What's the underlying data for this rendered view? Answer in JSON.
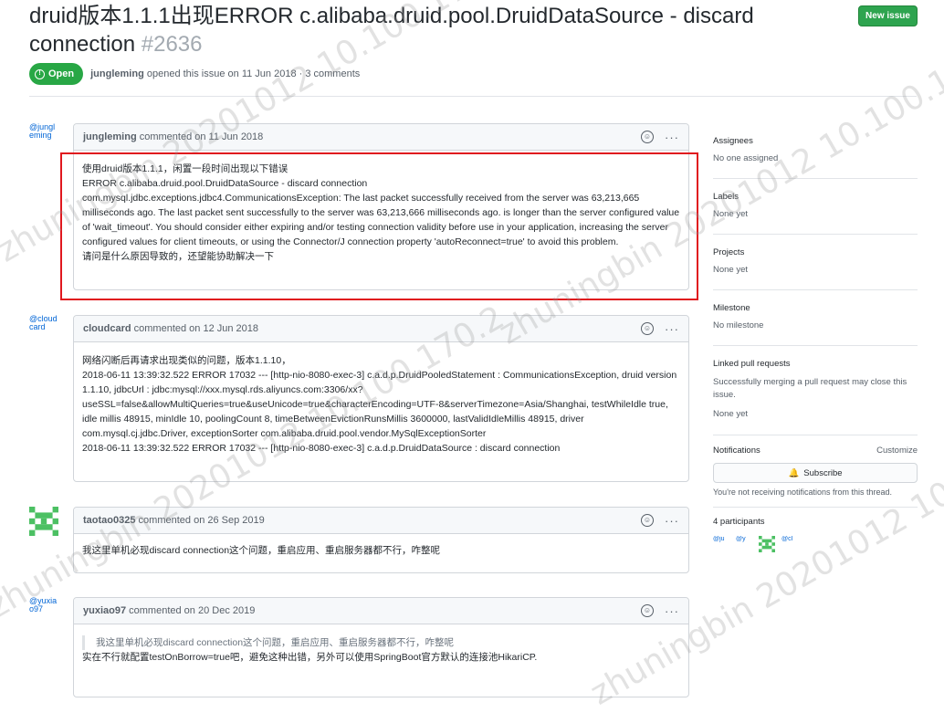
{
  "issue": {
    "title": "druid版本1.1.1出现ERROR c.alibaba.druid.pool.DruidDataSource - discard connection",
    "number": "#2636",
    "state": "Open",
    "author": "jungleming",
    "opened_text": "opened this issue on 11 Jun 2018 · 3 comments"
  },
  "header": {
    "new_issue_label": "New issue"
  },
  "comments": [
    {
      "avatar_alt": "@jungleming",
      "author": "jungleming",
      "date": "commented on 11 Jun 2018",
      "lines": [
        "使用druid版本1.1.1，闲置一段时间出现以下错误",
        "ERROR c.alibaba.druid.pool.DruidDataSource - discard connection",
        "com.mysql.jdbc.exceptions.jdbc4.CommunicationsException: The last packet successfully received from the server was 63,213,665 milliseconds ago. The last packet sent successfully to the server was 63,213,666 milliseconds ago. is longer than the server configured value of 'wait_timeout'. You should consider either expiring and/or testing connection validity before use in your application, increasing the server configured values for client timeouts, or using the Connector/J connection property 'autoReconnect=true' to avoid this problem.",
        "请问是什么原因导致的，还望能协助解决一下"
      ]
    },
    {
      "avatar_alt": "@cloudcard",
      "author": "cloudcard",
      "date": "commented on 12 Jun 2018",
      "lines": [
        "网络闪断后再请求出现类似的问题，版本1.1.10，",
        "2018-06-11 13:39:32.522 ERROR 17032 --- [http-nio-8080-exec-3] c.a.d.p.DruidPooledStatement : CommunicationsException, druid version 1.1.10, jdbcUrl : jdbc:mysql://xxx.mysql.rds.aliyuncs.com:3306/xx?useSSL=false&allowMultiQueries=true&useUnicode=true&characterEncoding=UTF-8&serverTimezone=Asia/Shanghai, testWhileIdle true, idle millis 48915, minIdle 10, poolingCount 8, timeBetweenEvictionRunsMillis 3600000, lastValidIdleMillis 48915, driver com.mysql.cj.jdbc.Driver, exceptionSorter com.alibaba.druid.pool.vendor.MySqlExceptionSorter",
        "2018-06-11 13:39:32.522 ERROR 17032 --- [http-nio-8080-exec-3] c.a.d.p.DruidDataSource : discard connection"
      ]
    },
    {
      "avatar_alt": "",
      "author": "taotao0325",
      "date": "commented on 26 Sep 2019",
      "lines": [
        "我这里单机必现discard connection这个问题，重启应用、重启服务器都不行，咋整呢"
      ]
    },
    {
      "avatar_alt": "@yuxiao97",
      "author": "yuxiao97",
      "date": "commented on 20 Dec 2019",
      "quote": "我这里单机必现discard connection这个问题，重启应用、重启服务器都不行，咋整呢",
      "lines": [
        "实在不行就配置testOnBorrow=true吧，避免这种出错，另外可以使用SpringBoot官方默认的连接池HikariCP."
      ]
    }
  ],
  "sidebar": {
    "assignees": {
      "title": "Assignees",
      "value": "No one assigned"
    },
    "labels": {
      "title": "Labels",
      "value": "None yet"
    },
    "projects": {
      "title": "Projects",
      "value": "None yet"
    },
    "milestone": {
      "title": "Milestone",
      "value": "No milestone"
    },
    "linked": {
      "title": "Linked pull requests",
      "desc": "Successfully merging a pull request may close this issue.",
      "value": "None yet"
    },
    "notifications": {
      "title": "Notifications",
      "customize": "Customize",
      "subscribe": "Subscribe",
      "note": "You're not receiving notifications from this thread."
    },
    "participants": {
      "title": "4 participants",
      "avatars": [
        "@ju",
        "@y",
        "",
        "@cl"
      ]
    }
  },
  "watermark": "zhuningbin 20201012 10.100.170.2",
  "colors": {
    "open": "#28a745",
    "new_issue": "#2ea44f",
    "highlight": "#e0181e",
    "link": "#0366d6"
  }
}
